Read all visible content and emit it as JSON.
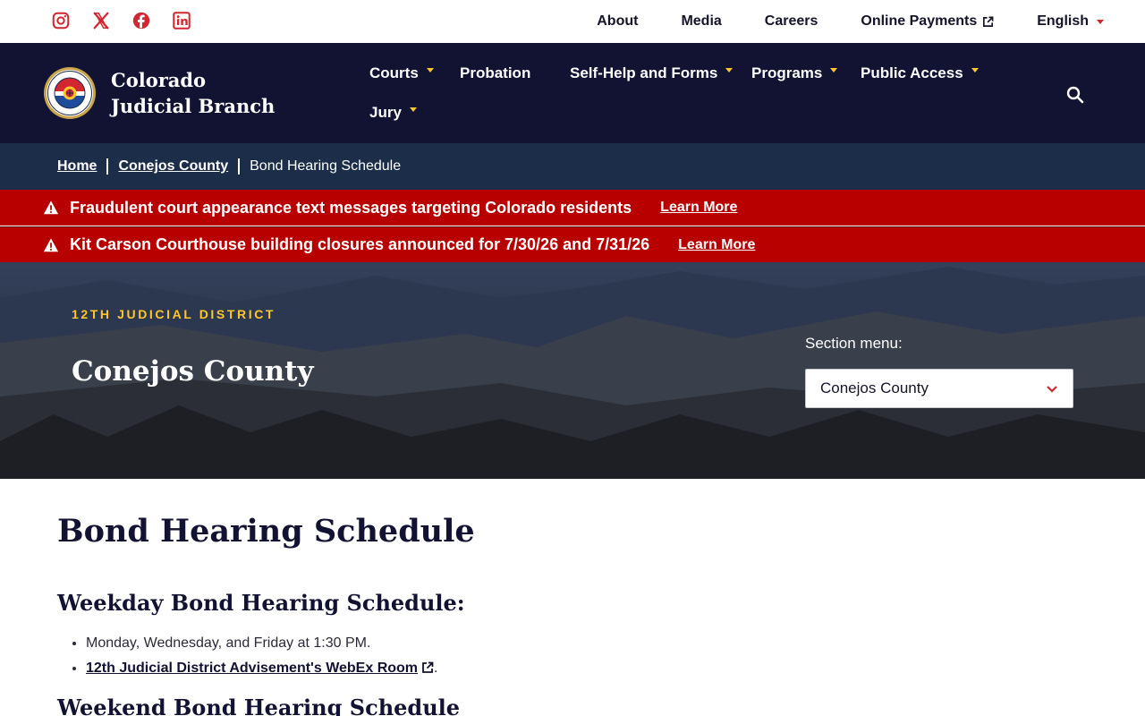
{
  "util": {
    "social": [
      "instagram-icon",
      "x-icon",
      "facebook-icon",
      "linkedin-icon"
    ],
    "links": {
      "about": "About",
      "media": "Media",
      "careers": "Careers",
      "payments": "Online Payments",
      "language": "English"
    }
  },
  "nav": {
    "brand": "Colorado Judicial Branch",
    "items": {
      "courts": "Courts",
      "probation": "Probation",
      "selfhelp": "Self-Help and Forms",
      "programs": "Programs",
      "public_access": "Public Access",
      "jury": "Jury"
    }
  },
  "breadcrumb": {
    "home": "Home",
    "county": "Conejos County",
    "current": "Bond Hearing Schedule"
  },
  "alerts": [
    {
      "text": "Fraudulent court appearance text messages targeting Colorado residents",
      "link": "Learn More"
    },
    {
      "text": "Kit Carson Courthouse building closures announced for 7/30/26 and 7/31/26",
      "link": "Learn More"
    }
  ],
  "hero": {
    "eyebrow": "12TH JUDICIAL DISTRICT",
    "title": "Conejos County",
    "section_label": "Section menu:",
    "section_value": "Conejos County"
  },
  "content": {
    "title": "Bond Hearing Schedule",
    "weekday_heading": "Weekday Bond Hearing Schedule:",
    "weekday_items": {
      "schedule": "Monday, Wednesday, and Friday at 1:30 PM.",
      "webex_link": "12th Judicial District Advisement's WebEx Room",
      "webex_suffix": "."
    },
    "weekend_heading": "Weekend Bond Hearing Schedule"
  },
  "colors": {
    "navy": "#121233",
    "breadcrumb": "#1b2d48",
    "alert": "#b90000",
    "gold": "#ffc72c",
    "accent_red": "#d22630"
  }
}
